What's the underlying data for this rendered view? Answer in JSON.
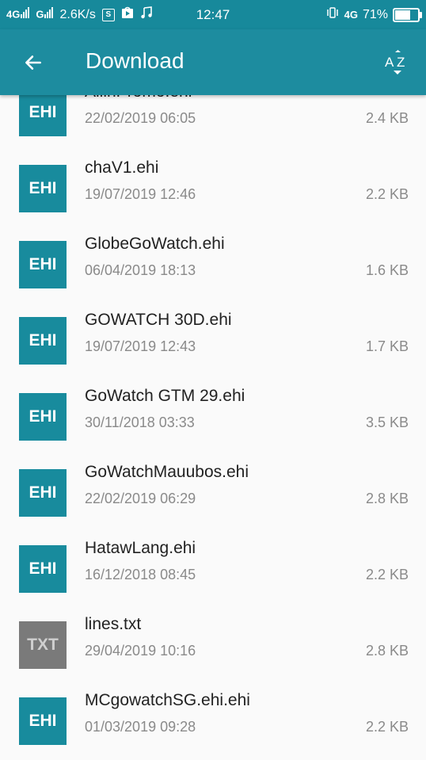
{
  "status_bar": {
    "sim1_label": "4G",
    "sim2_label": "G",
    "speed": "2.6K/s",
    "time": "12:47",
    "network": "4G",
    "battery_percent": "71%",
    "battery_level": 0.71,
    "icons": [
      "signal-icon",
      "s-app-icon",
      "play-store-icon",
      "music-icon",
      "vibrate-icon",
      "battery-icon"
    ]
  },
  "app_bar": {
    "title": "Download",
    "back_icon": "arrow-left-icon",
    "sort_icon": "sort-az-icon",
    "sort_label": "AZ"
  },
  "files": [
    {
      "badge": "EHI",
      "type": "ehi",
      "name": "AllinPromo.ehi",
      "date": "22/02/2019 06:05",
      "size": "2.4 KB"
    },
    {
      "badge": "EHI",
      "type": "ehi",
      "name": "chaV1.ehi",
      "date": "19/07/2019 12:46",
      "size": "2.2 KB"
    },
    {
      "badge": "EHI",
      "type": "ehi",
      "name": "GlobeGoWatch.ehi",
      "date": "06/04/2019 18:13",
      "size": "1.6 KB"
    },
    {
      "badge": "EHI",
      "type": "ehi",
      "name": "GOWATCH 30D.ehi",
      "date": "19/07/2019 12:43",
      "size": "1.7 KB"
    },
    {
      "badge": "EHI",
      "type": "ehi",
      "name": "GoWatch GTM 29.ehi",
      "date": "30/11/2018 03:33",
      "size": "3.5 KB"
    },
    {
      "badge": "EHI",
      "type": "ehi",
      "name": "GoWatchMauubos.ehi",
      "date": "22/02/2019 06:29",
      "size": "2.8 KB"
    },
    {
      "badge": "EHI",
      "type": "ehi",
      "name": "HatawLang.ehi",
      "date": "16/12/2018 08:45",
      "size": "2.2 KB"
    },
    {
      "badge": "TXT",
      "type": "txt",
      "name": "lines.txt",
      "date": "29/04/2019 10:16",
      "size": "2.8 KB"
    },
    {
      "badge": "EHI",
      "type": "ehi",
      "name": "MCgowatchSG.ehi.ehi",
      "date": "01/03/2019 09:28",
      "size": "2.2 KB"
    }
  ]
}
